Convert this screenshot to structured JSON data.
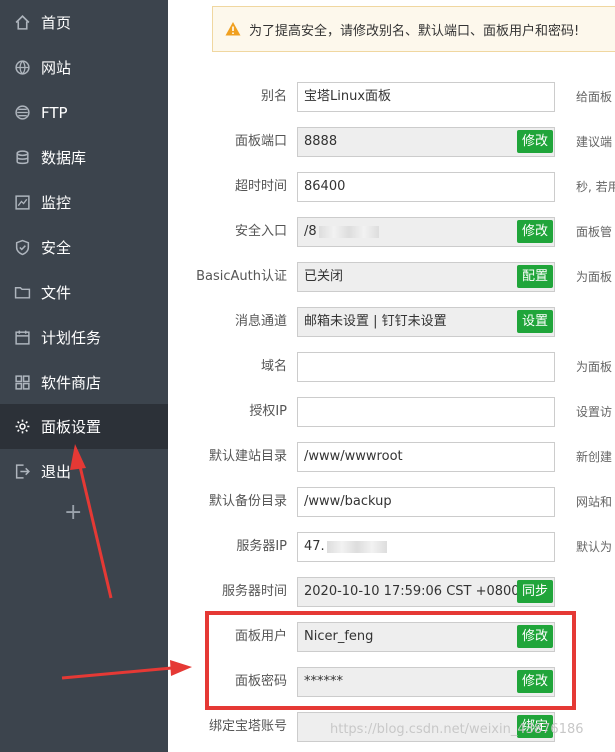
{
  "sidebar": {
    "items": [
      {
        "label": "首页",
        "icon": "home-icon"
      },
      {
        "label": "网站",
        "icon": "globe-icon"
      },
      {
        "label": "FTP",
        "icon": "ftp-icon"
      },
      {
        "label": "数据库",
        "icon": "database-icon"
      },
      {
        "label": "监控",
        "icon": "monitor-icon"
      },
      {
        "label": "安全",
        "icon": "shield-icon"
      },
      {
        "label": "文件",
        "icon": "folder-icon"
      },
      {
        "label": "计划任务",
        "icon": "calendar-icon"
      },
      {
        "label": "软件商店",
        "icon": "grid-icon"
      },
      {
        "label": "面板设置",
        "icon": "gear-icon",
        "active": true
      },
      {
        "label": "退出",
        "icon": "logout-icon"
      }
    ],
    "add_symbol": "+"
  },
  "notice": {
    "text": "为了提高安全，请修改别名、默认端口、面板用户和密码!"
  },
  "settings": [
    {
      "label": "别名",
      "value": "宝塔Linux面板",
      "readonly": false,
      "button": "",
      "hint": "给面板"
    },
    {
      "label": "面板端口",
      "value": "8888",
      "readonly": true,
      "button": "修改",
      "hint": "建议端"
    },
    {
      "label": "超时时间",
      "value": "86400",
      "readonly": false,
      "button": "",
      "hint": "秒, 若用"
    },
    {
      "label": "安全入口",
      "value": "/8",
      "readonly": true,
      "button": "修改",
      "hint": "面板管"
    },
    {
      "label": "BasicAuth认证",
      "value": "已关闭",
      "readonly": true,
      "button": "配置",
      "hint": "为面板"
    },
    {
      "label": "消息通道",
      "value": "邮箱未设置 | 钉钉未设置",
      "readonly": true,
      "button": "设置",
      "hint": ""
    },
    {
      "label": "域名",
      "value": "",
      "readonly": false,
      "button": "",
      "hint": "为面板"
    },
    {
      "label": "授权IP",
      "value": "",
      "readonly": false,
      "button": "",
      "hint": "设置访"
    },
    {
      "label": "默认建站目录",
      "value": "/www/wwwroot",
      "readonly": false,
      "button": "",
      "hint": "新创建"
    },
    {
      "label": "默认备份目录",
      "value": "/www/backup",
      "readonly": false,
      "button": "",
      "hint": "网站和"
    },
    {
      "label": "服务器IP",
      "value": "47.",
      "readonly": false,
      "button": "",
      "hint": "默认为"
    },
    {
      "label": "服务器时间",
      "value": "2020-10-10 17:59:06 CST +0800",
      "readonly": true,
      "button": "同步",
      "hint": ""
    },
    {
      "label": "面板用户",
      "value": "Nicer_feng",
      "readonly": true,
      "button": "修改",
      "hint": ""
    },
    {
      "label": "面板密码",
      "value": "******",
      "readonly": true,
      "button": "修改",
      "hint": ""
    },
    {
      "label": "绑定宝塔账号",
      "value": "",
      "readonly": true,
      "button": "绑定",
      "hint": ""
    }
  ],
  "watermark": "https://blog.csdn.net/weixin_43876186",
  "colors": {
    "sidebar": "#3c444d",
    "active": "#2c3138",
    "button": "#20a53a",
    "highlight": "#e53935"
  }
}
